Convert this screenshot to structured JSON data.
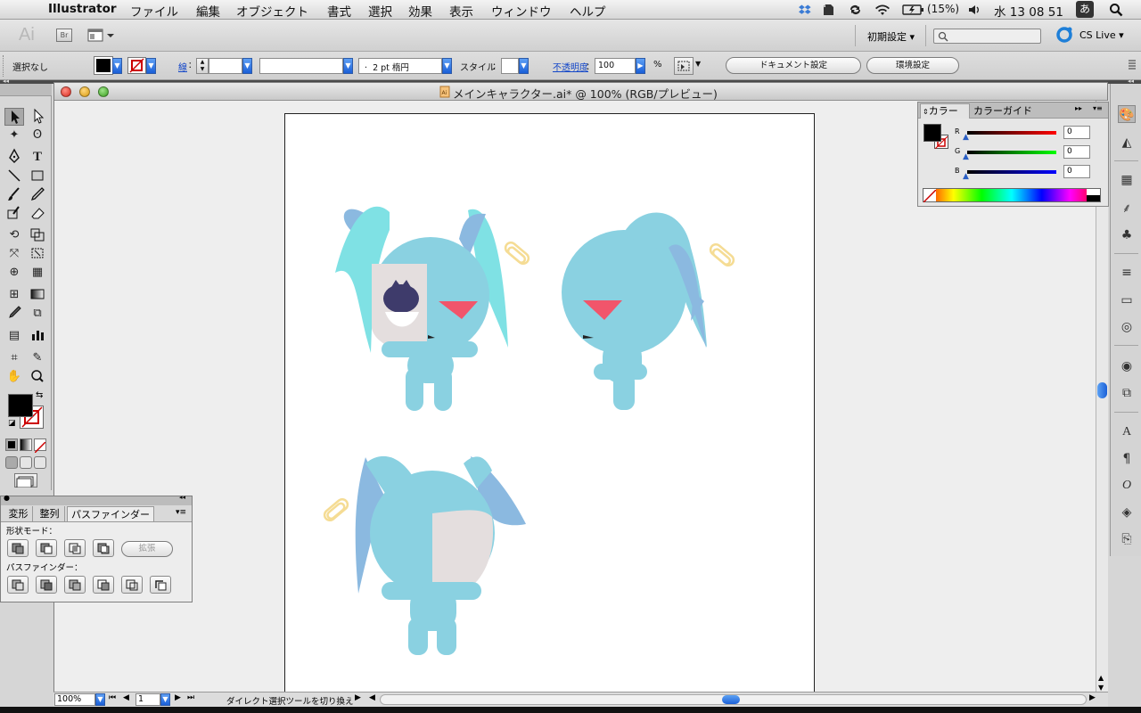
{
  "menubar": {
    "app_name": "Illustrator",
    "items": [
      "ファイル",
      "編集",
      "オブジェクト",
      "書式",
      "選択",
      "効果",
      "表示",
      "ウィンドウ",
      "ヘルプ"
    ],
    "battery": "(15%)",
    "clock": "水 13 08 51",
    "input_method": "あ"
  },
  "appbar": {
    "ai_logo": "Ai",
    "bridge_label": "Br",
    "workspace": "初期設定",
    "search_placeholder": "",
    "cs_live": "CS Live"
  },
  "control_bar": {
    "selection_status": "選択なし",
    "stroke_label": "線",
    "brush_value": "2 pt 楕円",
    "style_label": "スタイル",
    "opacity_label": "不透明度",
    "opacity_value": "100",
    "percent": "%",
    "document_setup_button": "ドキュメント設定",
    "preferences_button": "環境設定"
  },
  "document": {
    "title": "メインキャラクター.ai* @ 100% (RGB/プレビュー)"
  },
  "pathfinder_panel": {
    "tabs": [
      "変形",
      "整列",
      "パスファインダー"
    ],
    "active_tab": "パスファインダー",
    "shape_modes_label": "形状モード：",
    "expand_button": "拡張",
    "pathfinders_label": "パスファインダー："
  },
  "color_panel": {
    "tabs": [
      "カラー",
      "カラーガイド"
    ],
    "channels": [
      {
        "label": "R",
        "value": "0"
      },
      {
        "label": "G",
        "value": "0"
      },
      {
        "label": "B",
        "value": "0"
      }
    ]
  },
  "status_bar": {
    "zoom": "100%",
    "page": "1",
    "tool_hint": "ダイレクト選択ツールを切り換え"
  },
  "colors": {
    "character_body": "#8ad1e1",
    "hair_light": "#7fe1e4",
    "hair_shade": "#8bb9e0",
    "face_patch": "#e4dede",
    "eye": "#3e3b6b",
    "mouth": "#f1556b",
    "clip": "#f5dc94"
  }
}
